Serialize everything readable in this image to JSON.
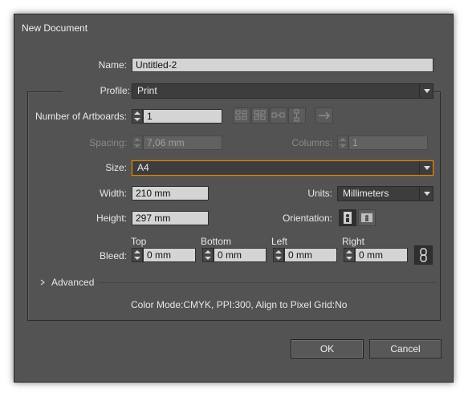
{
  "window": {
    "title": "New Document"
  },
  "name": {
    "label": "Name:",
    "value": "Untitled-2"
  },
  "profile": {
    "label": "Profile:",
    "value": "Print"
  },
  "artboards": {
    "label": "Number of Artboards:",
    "value": "1"
  },
  "spacing": {
    "label": "Spacing:",
    "value": "7,06 mm"
  },
  "columns": {
    "label": "Columns:",
    "value": "1"
  },
  "size": {
    "label": "Size:",
    "value": "A4"
  },
  "width": {
    "label": "Width:",
    "value": "210 mm"
  },
  "units": {
    "label": "Units:",
    "value": "Millimeters"
  },
  "height": {
    "label": "Height:",
    "value": "297 mm"
  },
  "orientation": {
    "label": "Orientation:"
  },
  "bleed": {
    "label": "Bleed:",
    "top": {
      "label": "Top",
      "value": "0 mm"
    },
    "bottom": {
      "label": "Bottom",
      "value": "0 mm"
    },
    "left": {
      "label": "Left",
      "value": "0 mm"
    },
    "right": {
      "label": "Right",
      "value": "0 mm"
    }
  },
  "advanced": {
    "label": "Advanced"
  },
  "summary": "Color Mode:CMYK, PPI:300, Align to Pixel Grid:No",
  "buttons": {
    "ok": "OK",
    "cancel": "Cancel"
  },
  "icons": {
    "grid_by_row": "grid-by-row-icon",
    "grid_by_column": "grid-by-column-icon",
    "arrange_by_row": "arrange-by-row-icon",
    "arrange_by_column": "arrange-by-column-icon",
    "layout_direction": "arrow-right-icon",
    "portrait": "portrait-icon",
    "landscape": "landscape-icon",
    "link": "link-chain-icon",
    "disclosure": "chevron-right-icon"
  },
  "colors": {
    "dialog_bg": "#535353",
    "focus_ring": "#d08a2c",
    "field_bg": "#d4d4d4"
  }
}
